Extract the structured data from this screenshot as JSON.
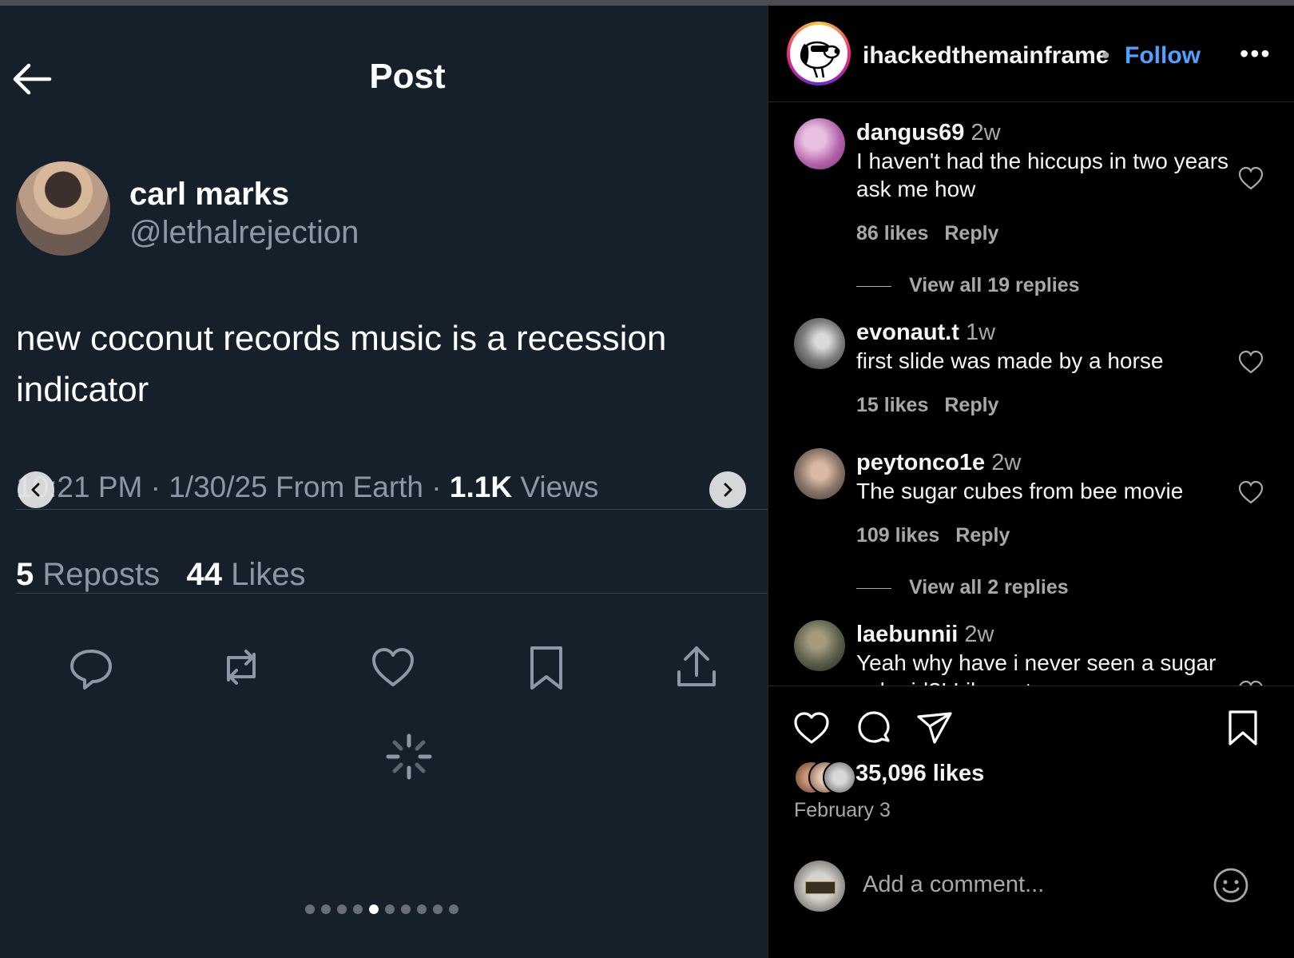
{
  "post": {
    "header_title": "Post",
    "author_name": "carl marks",
    "author_handle": "@lethalrejection",
    "text": "new coconut records music is a recession indicator",
    "time_date_prefix": "10:21 PM · 1/30/25 From Earth · ",
    "views_count": "1.1K",
    "views_label": " Views",
    "reposts_count": "5",
    "reposts_label": " Reposts",
    "likes_count": "44",
    "likes_label": " Likes",
    "carousel": {
      "total": 10,
      "active_index": 4
    }
  },
  "ig": {
    "username": "ihackedthemainframe",
    "separator": "•",
    "follow_label": "Follow",
    "more_label": "•••",
    "comments": [
      {
        "user": "dangus69",
        "age": "2w",
        "text": "I haven't had the hiccups in two years ask me how",
        "likes": "86 likes",
        "reply": "Reply",
        "view_replies": "View all 19 replies",
        "avatar_color": "#b05fa8"
      },
      {
        "user": "evonaut.t",
        "age": "1w",
        "text": "first slide was made by a horse",
        "likes": "15 likes",
        "reply": "Reply",
        "avatar_color": "#7d7d7d"
      },
      {
        "user": "peytonco1e",
        "age": "2w",
        "text": "The sugar cubes from bee movie",
        "likes": "109 likes",
        "reply": "Reply",
        "view_replies": "View all 2 replies",
        "avatar_color": "#8a7467"
      },
      {
        "user": "laebunnii",
        "age": "2w",
        "text": "Yeah why have i never seen a sugar cube irl?! Like not even once",
        "avatar_color": "#5b5f4a"
      }
    ],
    "likes_count": "35,096 likes",
    "date": "February 3",
    "add_comment_placeholder": "Add a comment..."
  },
  "colors": {
    "twitter_bg": "#15202b",
    "ig_bg": "#000000",
    "follow_blue": "#4da3ff",
    "muted": "#8b98a5"
  }
}
